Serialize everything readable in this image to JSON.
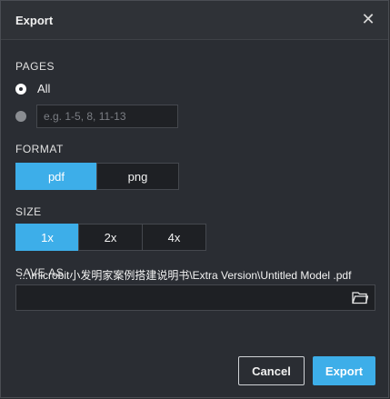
{
  "dialog": {
    "title": "Export",
    "close_icon": "close-icon"
  },
  "pages": {
    "label": "PAGES",
    "all_label": "All",
    "selected": "all",
    "range_placeholder": "e.g. 1-5, 8, 11-13"
  },
  "format": {
    "label": "FORMAT",
    "options": [
      "pdf",
      "png"
    ],
    "selected": "pdf"
  },
  "size": {
    "label": "SIZE",
    "options": [
      "1x",
      "2x",
      "4x"
    ],
    "selected": "1x"
  },
  "save_as": {
    "label": "SAVE AS",
    "path": "...\\microbit小发明家案例搭建说明书\\Extra Version\\Untitled Model .pdf",
    "browse_icon": "folder-icon"
  },
  "buttons": {
    "cancel": "Cancel",
    "export": "Export"
  },
  "colors": {
    "accent": "#3daee9",
    "background": "#2a2d33",
    "field": "#1e2024"
  }
}
